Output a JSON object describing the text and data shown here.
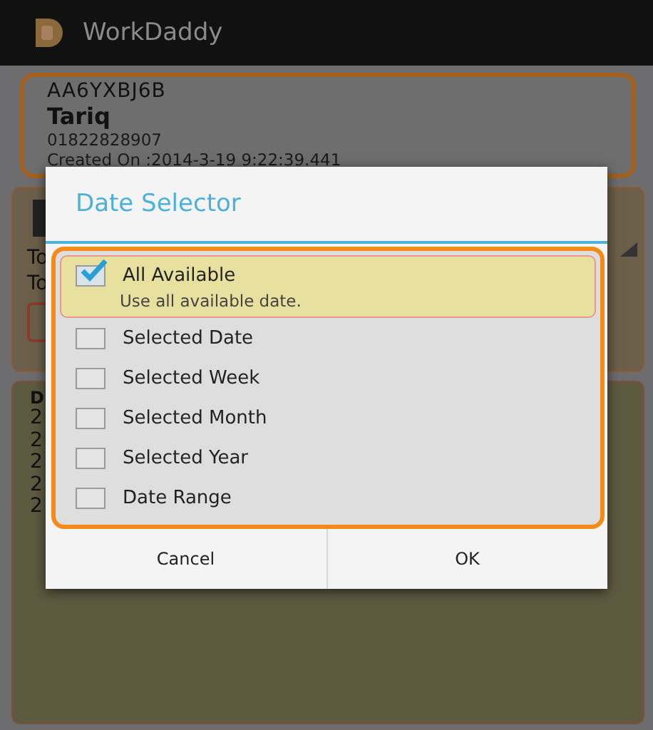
{
  "app_bar": {
    "title": "WorkDaddy"
  },
  "customer": {
    "code": "AA6YXBJ6B",
    "name": "Tariq",
    "phone": "01822828907",
    "created": "Created On :2014-3-19 9:22:39.441"
  },
  "background_panel": {
    "lines": [
      "To",
      "To"
    ]
  },
  "background_list": {
    "header": "D",
    "rows": [
      "2",
      "2",
      "2",
      "2",
      "2"
    ]
  },
  "dialog": {
    "title": "Date Selector",
    "options": [
      {
        "label": "All Available",
        "description": "Use all available date.",
        "checked": true
      },
      {
        "label": "Selected Date",
        "checked": false
      },
      {
        "label": "Selected Week",
        "checked": false
      },
      {
        "label": "Selected Month",
        "checked": false
      },
      {
        "label": "Selected Year",
        "checked": false
      },
      {
        "label": "Date Range",
        "checked": false
      }
    ],
    "buttons": [
      "Cancel",
      "OK"
    ]
  }
}
